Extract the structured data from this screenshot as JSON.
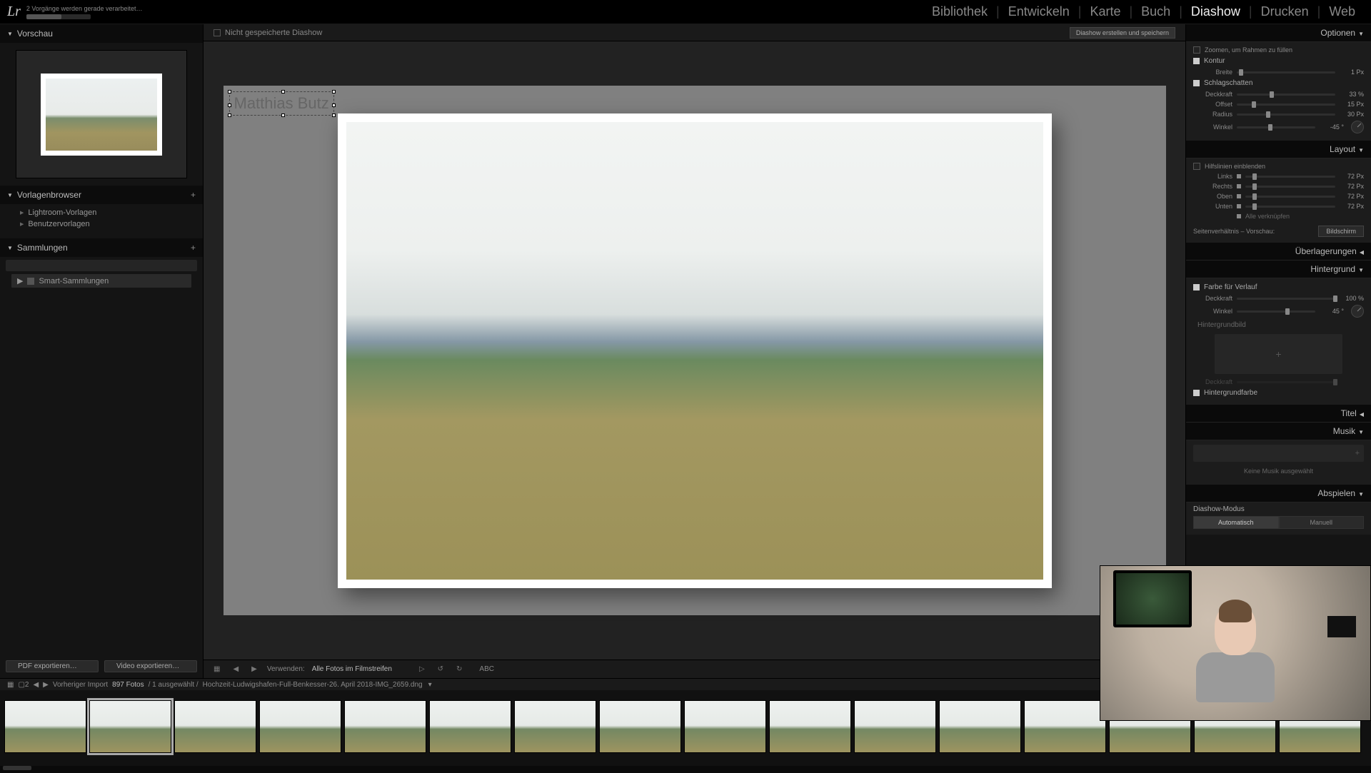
{
  "header": {
    "logo": "Lr",
    "progress_text": "2 Vorgänge werden gerade verarbeitet…",
    "modules": {
      "bibliothek": "Bibliothek",
      "entwickeln": "Entwickeln",
      "karte": "Karte",
      "buch": "Buch",
      "diashow": "Diashow",
      "drucken": "Drucken",
      "web": "Web"
    }
  },
  "left": {
    "preview_hdr": "Vorschau",
    "templates_hdr": "Vorlagenbrowser",
    "templates": {
      "lr": "Lightroom-Vorlagen",
      "user": "Benutzervorlagen"
    },
    "collections_hdr": "Sammlungen",
    "smart": "Smart-Sammlungen",
    "export_pdf": "PDF exportieren…",
    "export_video": "Video exportieren…"
  },
  "center": {
    "title": "Nicht gespeicherte Diashow",
    "save_btn": "Diashow erstellen und speichern",
    "overlay_text": "Matthias Butz",
    "tools": {
      "verwenden": "Verwenden:",
      "mode": "Alle Fotos im Filmstreifen",
      "abc": "ABC"
    }
  },
  "right": {
    "optionen": "Optionen",
    "zoom_fill": "Zoomen, um Rahmen zu füllen",
    "kontur": "Kontur",
    "breite": "Breite",
    "breite_v": "1 Px",
    "schlagschatten": "Schlagschatten",
    "deckkraft": "Deckkraft",
    "deckkraft_v": "33 %",
    "offset": "Offset",
    "offset_v": "15 Px",
    "radius": "Radius",
    "radius_v": "30 Px",
    "winkel": "Winkel",
    "winkel_v": "-45 °",
    "layout": "Layout",
    "hilfslinien": "Hilfslinien einblenden",
    "links": "Links",
    "rechts": "Rechts",
    "oben": "Oben",
    "unten": "Unten",
    "margin_v": "72 Px",
    "alle": "Alle verknüpfen",
    "aspect_lbl": "Seitenverhältnis – Vorschau:",
    "aspect_v": "Bildschirm",
    "uberlagerungen": "Überlagerungen",
    "hintergrund": "Hintergrund",
    "farbverlauf": "Farbe für Verlauf",
    "hg_deckkraft": "Deckkraft",
    "hg_deckkraft_v": "100 %",
    "hg_winkel": "Winkel",
    "hg_winkel_v": "45 °",
    "hg_bild": "Hintergrundbild",
    "hg_bild_deck": "Deckkraft",
    "hg_farbe": "Hintergrundfarbe",
    "titel": "Titel",
    "musik": "Musik",
    "keine_musik": "Keine Musik ausgewählt",
    "abspielen": "Abspielen",
    "diashow_modus": "Diashow-Modus",
    "auto": "Automatisch",
    "manuell": "Manuell"
  },
  "filmstrip": {
    "prev_import": "Vorheriger Import",
    "count": "897 Fotos",
    "sel": "/ 1 ausgewählt /",
    "path": "Hochzeit-Ludwigshafen-Full-Benkesser-26. April 2018-IMG_2659.dng"
  }
}
